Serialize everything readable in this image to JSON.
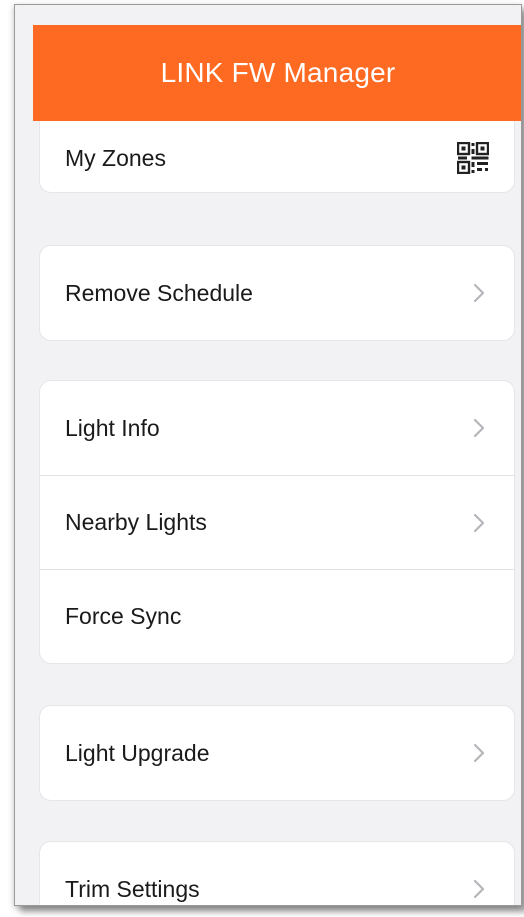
{
  "header": {
    "title": "LINK FW Manager"
  },
  "groups": [
    {
      "items": [
        {
          "label": "My Zones",
          "icon": "qr-code-icon"
        }
      ]
    },
    {
      "items": [
        {
          "label": "Remove Schedule",
          "icon": "chevron-right-icon"
        }
      ]
    },
    {
      "items": [
        {
          "label": "Light Info",
          "icon": "chevron-right-icon"
        },
        {
          "label": "Nearby Lights",
          "icon": "chevron-right-icon"
        },
        {
          "label": "Force Sync",
          "icon": ""
        }
      ]
    },
    {
      "items": [
        {
          "label": "Light Upgrade",
          "icon": "chevron-right-icon"
        }
      ]
    },
    {
      "items": [
        {
          "label": "Trim Settings",
          "icon": "chevron-right-icon"
        }
      ]
    }
  ],
  "colors": {
    "accent": "#ff6a22",
    "background": "#f2f2f4",
    "card": "#ffffff",
    "chevron": "#b5b5ba"
  }
}
